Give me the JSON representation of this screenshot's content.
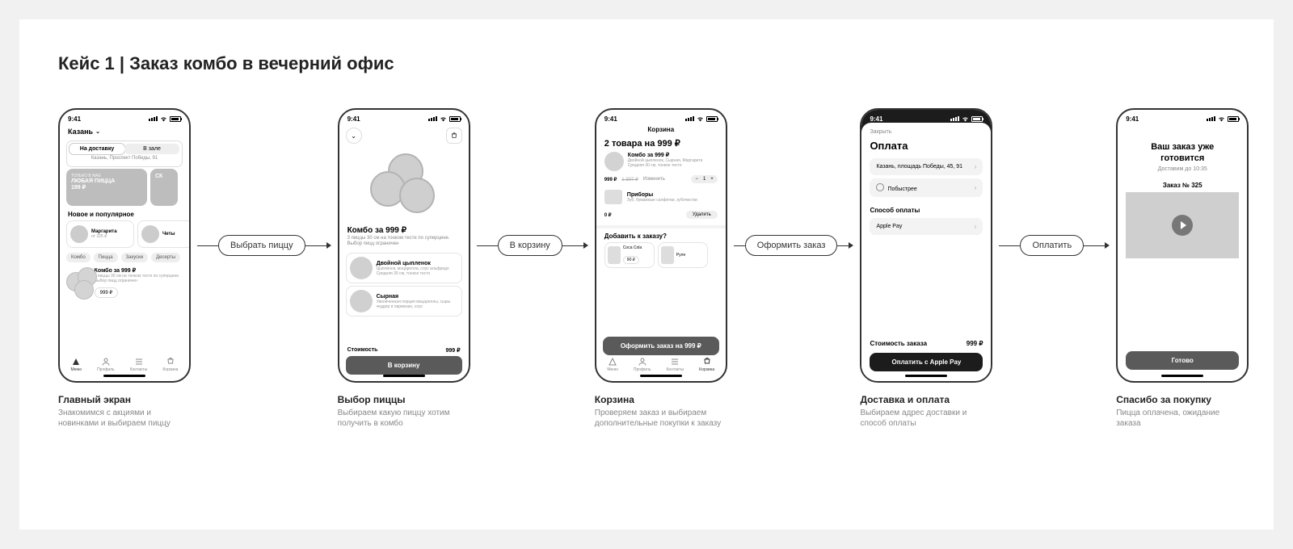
{
  "title": "Кейс 1 | Заказ  комбо в вечерний офис",
  "common": {
    "time": "9:41",
    "tabs": [
      "Меню",
      "Профиль",
      "Контакты",
      "Корзина"
    ]
  },
  "flow": [
    "Выбрать пиццу",
    "В корзину",
    "Оформить заказ",
    "Оплатить"
  ],
  "labels": [
    {
      "t": "Главный экран",
      "s": "Знакомимся с акциями и новинками и выбираем пиццу"
    },
    {
      "t": "Выбор пиццы",
      "s": "Выбираем какую пиццу хотим получить в комбо"
    },
    {
      "t": "Корзина",
      "s": "Проверяем заказ и выбираем дополнительные покупки к заказу"
    },
    {
      "t": "Доставка и оплата",
      "s": "Выбираем адрес доставки и способ оплаты"
    },
    {
      "t": "Спасибо за покупку",
      "s": "Пицца оплачена, ожидание заказа"
    }
  ],
  "screens": {
    "home": {
      "city": "Казань",
      "seg_delivery": "На доставку",
      "seg_dinein": "В зале",
      "address": "Казань, Проспект Победы, 91",
      "promo1_tag": "ТОЛЬКО В МАЕ",
      "promo1_title": "ЛЮБАЯ ПИЦЦА",
      "promo1_price": "199 ₽",
      "promo2_partial": "СК",
      "section_new": "Новое и популярное",
      "card1_name": "Маргарита",
      "card1_price": "от 325 ₽",
      "card2_partial": "Четы",
      "chips": [
        "Комбо",
        "Пицца",
        "Закуски",
        "Десерты"
      ],
      "combo_title": "Комбо за 999 ₽",
      "combo_desc": "3 пиццы 30 см на тонком тесте по суперцене. Выбор пицц ограничен",
      "combo_price": "999 ₽"
    },
    "product": {
      "name": "Комбо за 999 ₽",
      "desc": "3 пиццы 30 см на тонком тесте по суперцене. Выбор пицц ограничен",
      "opt1_name": "Двойной цыпленок",
      "opt1_desc": "Цыпленок, моцарелла, соус альфредо",
      "opt1_meta": "Средняя 30 см, тонкое тесто",
      "opt2_name": "Сырная",
      "opt2_desc": "Увеличенная порция моцареллы, сыры чеддер и пармезан, соус",
      "cost_label": "Стоимость",
      "cost_value": "999 ₽",
      "btn": "В корзину"
    },
    "cart": {
      "header": "Корзина",
      "summary": "2 товара на 999 ₽",
      "item_title": "Комбо за 999 ₽",
      "item_sub1": "Двойной цыпленок, Сырная, Маргарита",
      "item_sub2": "Средняя 30 см, тонкое тесто",
      "price": "999 ₽",
      "old_price": "1 397 ₽",
      "change": "Изменить",
      "qty": "1",
      "utensils_title": "Приборы",
      "utensils_sub": "Зуб, бумажные салфетки, зубочистки",
      "utensils_price": "0 ₽",
      "remove": "Удалить",
      "upsell_q": "Добавить к заказу?",
      "rec1_name": "Coca Cola",
      "rec1_price": "90 ₽",
      "rec2_partial": "Руле",
      "order_btn": "Оформить заказ на 999 ₽"
    },
    "payment": {
      "close": "Закрыть",
      "header": "Оплата",
      "address": "Казань, площадь Победы, 45, 91",
      "timing": "Побыстрее",
      "method_header": "Способ оплаты",
      "method": "Apple Pay",
      "total_label": "Стоимость заказа",
      "total_value": "999 ₽",
      "pay_btn": "Оплатить с Apple Pay"
    },
    "success": {
      "msg": "Ваш заказ уже готовится",
      "eta": "Доставим до 10:35",
      "order": "Заказ № 325",
      "done": "Готово"
    }
  }
}
